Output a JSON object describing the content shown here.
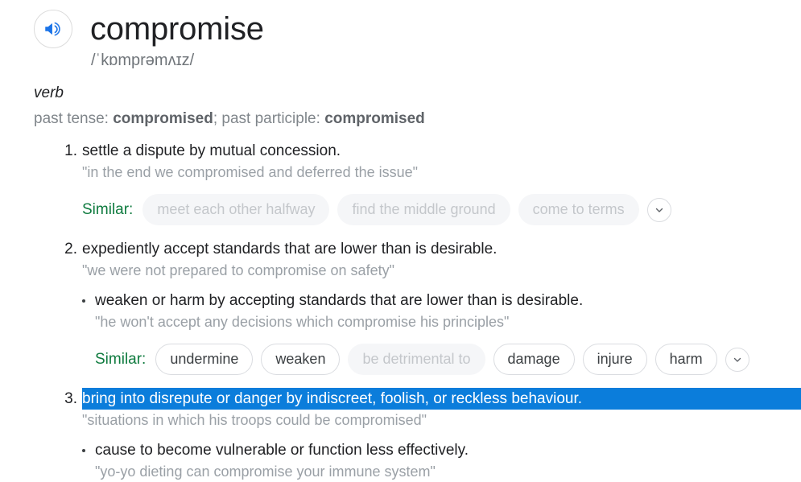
{
  "entry": {
    "headword": "compromise",
    "phonetic": "/ˈkɒmprəmʌɪz/",
    "part_of_speech": "verb",
    "inflection_label_1": "past tense: ",
    "inflection_value_1": "compromised",
    "inflection_separator": "; ",
    "inflection_label_2": "past participle: ",
    "inflection_value_2": "compromised",
    "speaker_icon": "speaker-icon"
  },
  "colors": {
    "accent_blue": "#1a73e8",
    "selection_blue": "#0b7ddb",
    "similar_green": "#0f7b3f",
    "muted_gray": "#9aa0a6",
    "faded_chip_text": "#c4c7cb"
  },
  "senses": [
    {
      "number": "1.",
      "definition": "settle a dispute by mutual concession.",
      "example": "\"in the end we compromised and deferred the issue\"",
      "selected": false,
      "similar": {
        "label": "Similar:",
        "chips": [
          {
            "text": "meet each other halfway",
            "style": "faded"
          },
          {
            "text": "find the middle ground",
            "style": "faded"
          },
          {
            "text": "come to terms",
            "style": "faded"
          }
        ],
        "expand_icon": "chevron-down-icon"
      },
      "subsenses": []
    },
    {
      "number": "2.",
      "definition": "expediently accept standards that are lower than is desirable.",
      "example": "\"we were not prepared to compromise on safety\"",
      "selected": false,
      "similar": null,
      "subsenses": [
        {
          "definition": "weaken or harm by accepting standards that are lower than is desirable.",
          "example": "\"he won't accept any decisions which compromise his principles\"",
          "similar": {
            "label": "Similar:",
            "chips": [
              {
                "text": "undermine",
                "style": "solid"
              },
              {
                "text": "weaken",
                "style": "solid"
              },
              {
                "text": "be detrimental to",
                "style": "faded"
              },
              {
                "text": "damage",
                "style": "solid"
              },
              {
                "text": "injure",
                "style": "solid"
              },
              {
                "text": "harm",
                "style": "solid"
              }
            ],
            "expand_icon": "chevron-down-icon"
          }
        }
      ]
    },
    {
      "number": "3.",
      "definition": "bring into disrepute or danger by indiscreet, foolish, or reckless behaviour.",
      "example": "\"situations in which his troops could be compromised\"",
      "selected": true,
      "similar": null,
      "subsenses": [
        {
          "definition": "cause to become vulnerable or function less effectively.",
          "example": "\"yo-yo dieting can compromise your immune system\"",
          "similar": null
        }
      ]
    }
  ]
}
